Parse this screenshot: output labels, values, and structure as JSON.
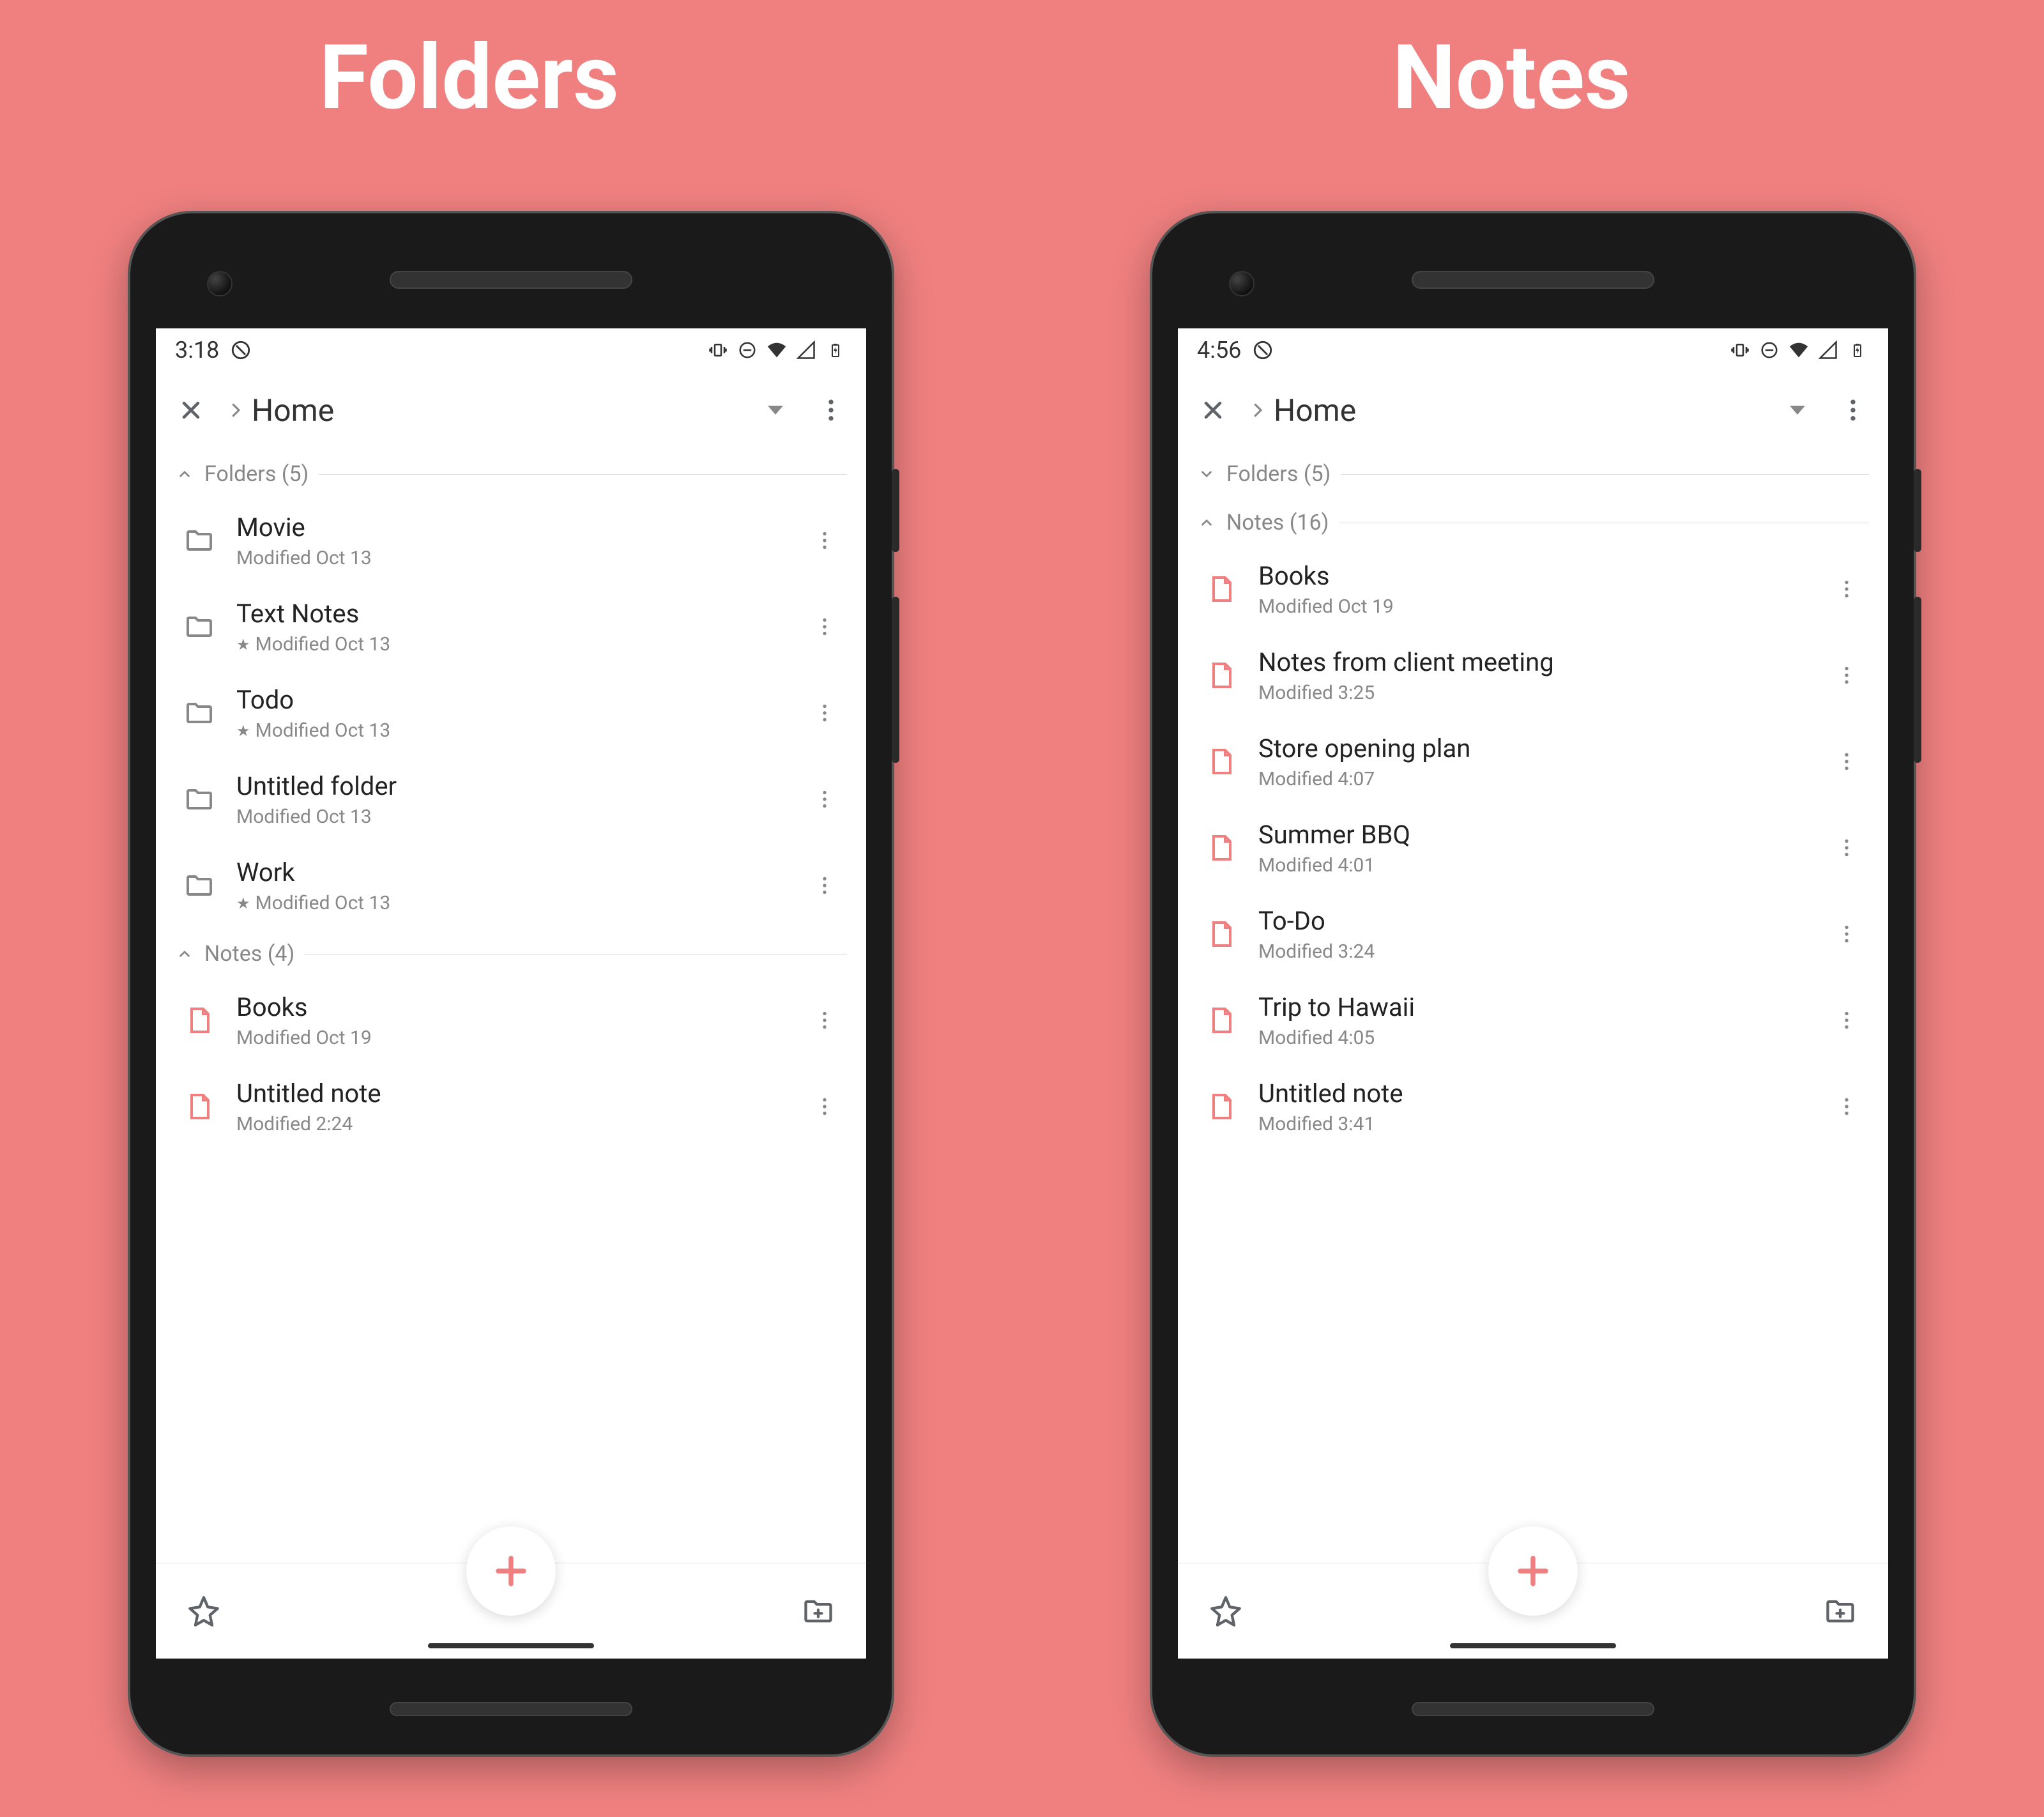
{
  "labels": {
    "left": "Folders",
    "right": "Notes"
  },
  "accent": "#f08080",
  "phones": [
    {
      "status": {
        "time": "3:18"
      },
      "appbar": {
        "breadcrumb": "Home"
      },
      "sections": [
        {
          "title": "Folders (5)",
          "expanded": true,
          "type": "folder",
          "items": [
            {
              "title": "Movie",
              "sub": "Modified Oct 13",
              "starred": false
            },
            {
              "title": "Text Notes",
              "sub": "Modified Oct 13",
              "starred": true
            },
            {
              "title": "Todo",
              "sub": "Modified Oct 13",
              "starred": true
            },
            {
              "title": "Untitled folder",
              "sub": "Modified Oct 13",
              "starred": false
            },
            {
              "title": "Work",
              "sub": "Modified Oct 13",
              "starred": true
            }
          ]
        },
        {
          "title": "Notes (4)",
          "expanded": true,
          "type": "note",
          "items": [
            {
              "title": "Books",
              "sub": "Modified Oct 19",
              "starred": false
            },
            {
              "title": "Untitled note",
              "sub": "Modified 2:24",
              "starred": false
            }
          ]
        }
      ]
    },
    {
      "status": {
        "time": "4:56"
      },
      "appbar": {
        "breadcrumb": "Home"
      },
      "sections": [
        {
          "title": "Folders (5)",
          "expanded": false,
          "type": "folder",
          "items": []
        },
        {
          "title": "Notes (16)",
          "expanded": true,
          "type": "note",
          "items": [
            {
              "title": "Books",
              "sub": "Modified Oct 19",
              "starred": false
            },
            {
              "title": "Notes from client meeting",
              "sub": "Modified 3:25",
              "starred": false
            },
            {
              "title": "Store opening plan",
              "sub": "Modified 4:07",
              "starred": false
            },
            {
              "title": "Summer BBQ",
              "sub": "Modified 4:01",
              "starred": false
            },
            {
              "title": "To-Do",
              "sub": "Modified 3:24",
              "starred": false
            },
            {
              "title": "Trip to Hawaii",
              "sub": "Modified 4:05",
              "starred": false
            },
            {
              "title": "Untitled note",
              "sub": "Modified 3:41",
              "starred": false
            }
          ]
        }
      ]
    }
  ]
}
